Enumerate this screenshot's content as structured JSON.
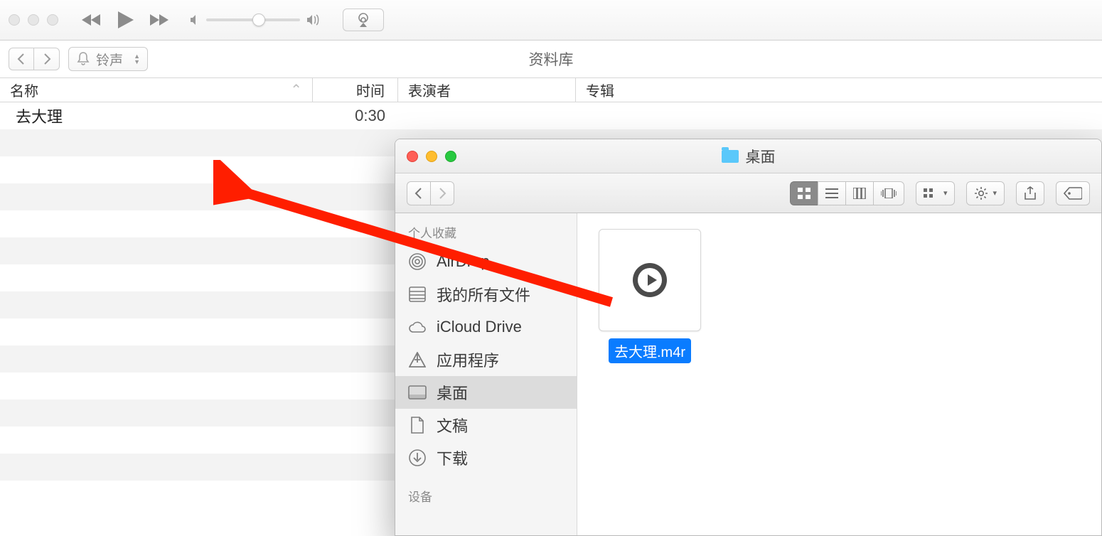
{
  "itunes": {
    "source_label": "铃声",
    "library_label": "资料库",
    "columns": {
      "name": "名称",
      "time": "时间",
      "artist": "表演者",
      "album": "专辑"
    },
    "tracks": [
      {
        "name": "去大理",
        "time": "0:30"
      }
    ]
  },
  "finder": {
    "title": "桌面",
    "favorites_header": "个人收藏",
    "devices_header": "设备",
    "sidebar": [
      {
        "icon": "airdrop",
        "label": "AirDrop"
      },
      {
        "icon": "allfiles",
        "label": "我的所有文件"
      },
      {
        "icon": "icloud",
        "label": "iCloud Drive"
      },
      {
        "icon": "apps",
        "label": "应用程序"
      },
      {
        "icon": "desktop",
        "label": "桌面",
        "active": true
      },
      {
        "icon": "docs",
        "label": "文稿"
      },
      {
        "icon": "downloads",
        "label": "下载"
      }
    ],
    "files": [
      {
        "name": "去大理.m4r"
      }
    ]
  }
}
